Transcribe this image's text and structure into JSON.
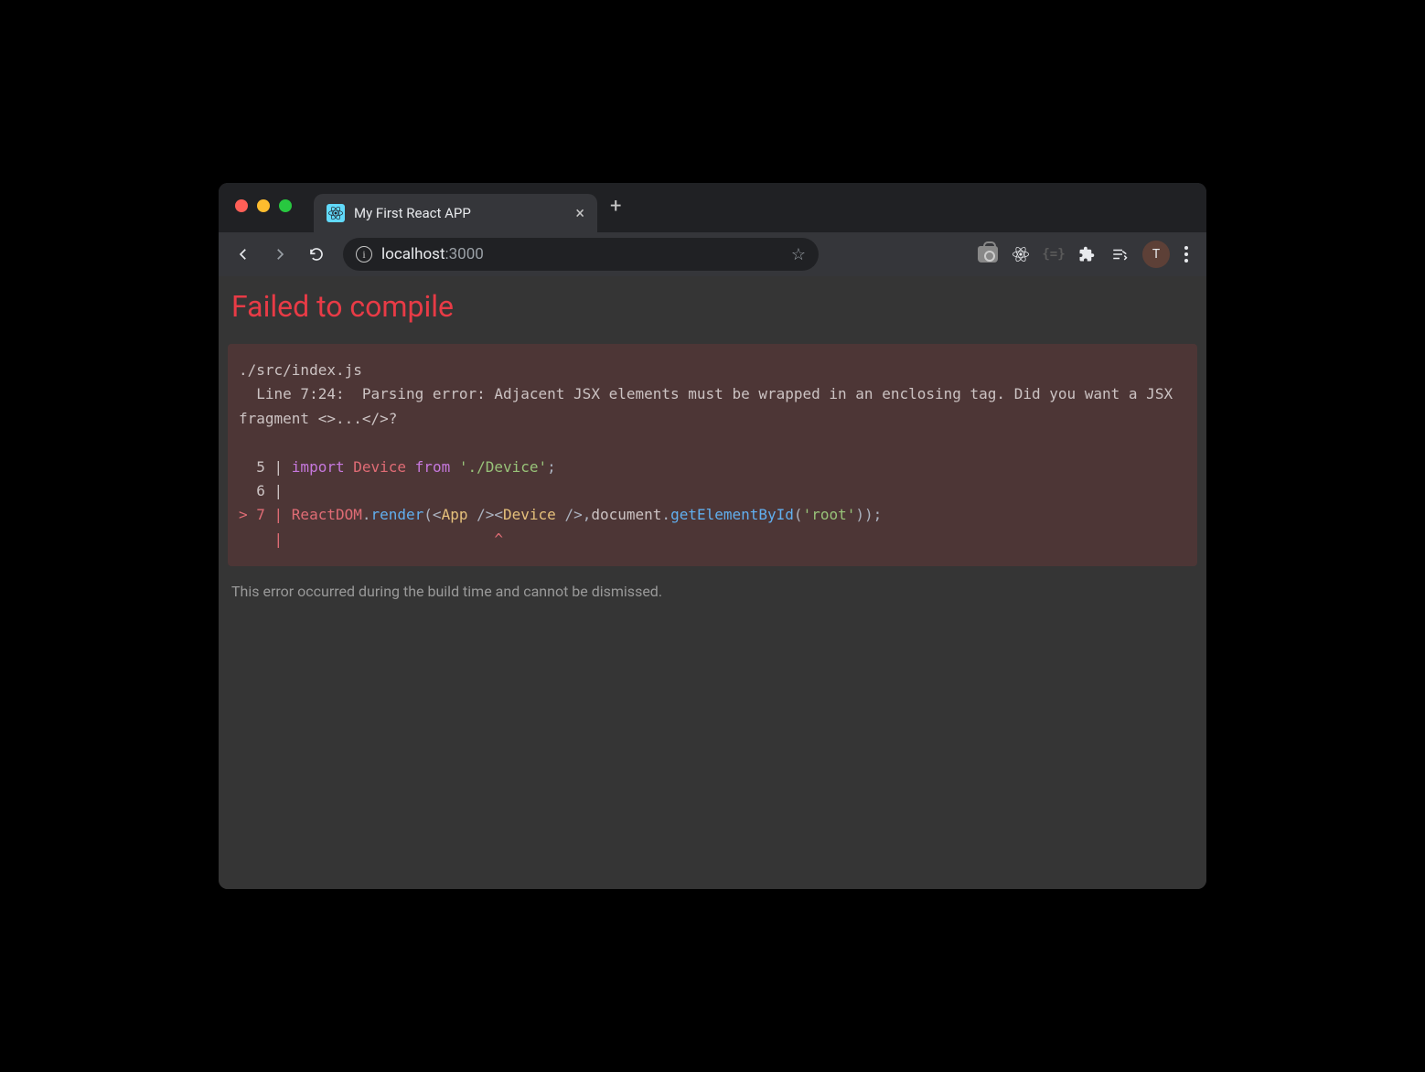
{
  "tab": {
    "title": "My First React APP"
  },
  "omnibox": {
    "host": "localhost",
    "port": ":3000"
  },
  "avatar": {
    "initial": "T"
  },
  "page": {
    "title": "Failed to compile",
    "footer": "This error occurred during the build time and cannot be dismissed."
  },
  "error": {
    "file": "./src/index.js",
    "location": "  Line 7:24:  Parsing error: Adjacent JSX elements must be wrapped in an enclosing tag. Did you want a JSX fragment <>...</>?",
    "code": {
      "line5": {
        "prefix": "  5 | ",
        "import": "import",
        "device": "Device",
        "from": "from",
        "path": "'./Device'",
        "semi": ";"
      },
      "line6": {
        "text": "  6 | "
      },
      "line7": {
        "prefix": "> 7 | ",
        "reactdom": "ReactDOM",
        "render": "render",
        "app": "App",
        "device": "Device",
        "doc": "document",
        "getById": "getElementById",
        "root": "'root'"
      },
      "caret": {
        "text": "    |                        ^"
      }
    }
  }
}
